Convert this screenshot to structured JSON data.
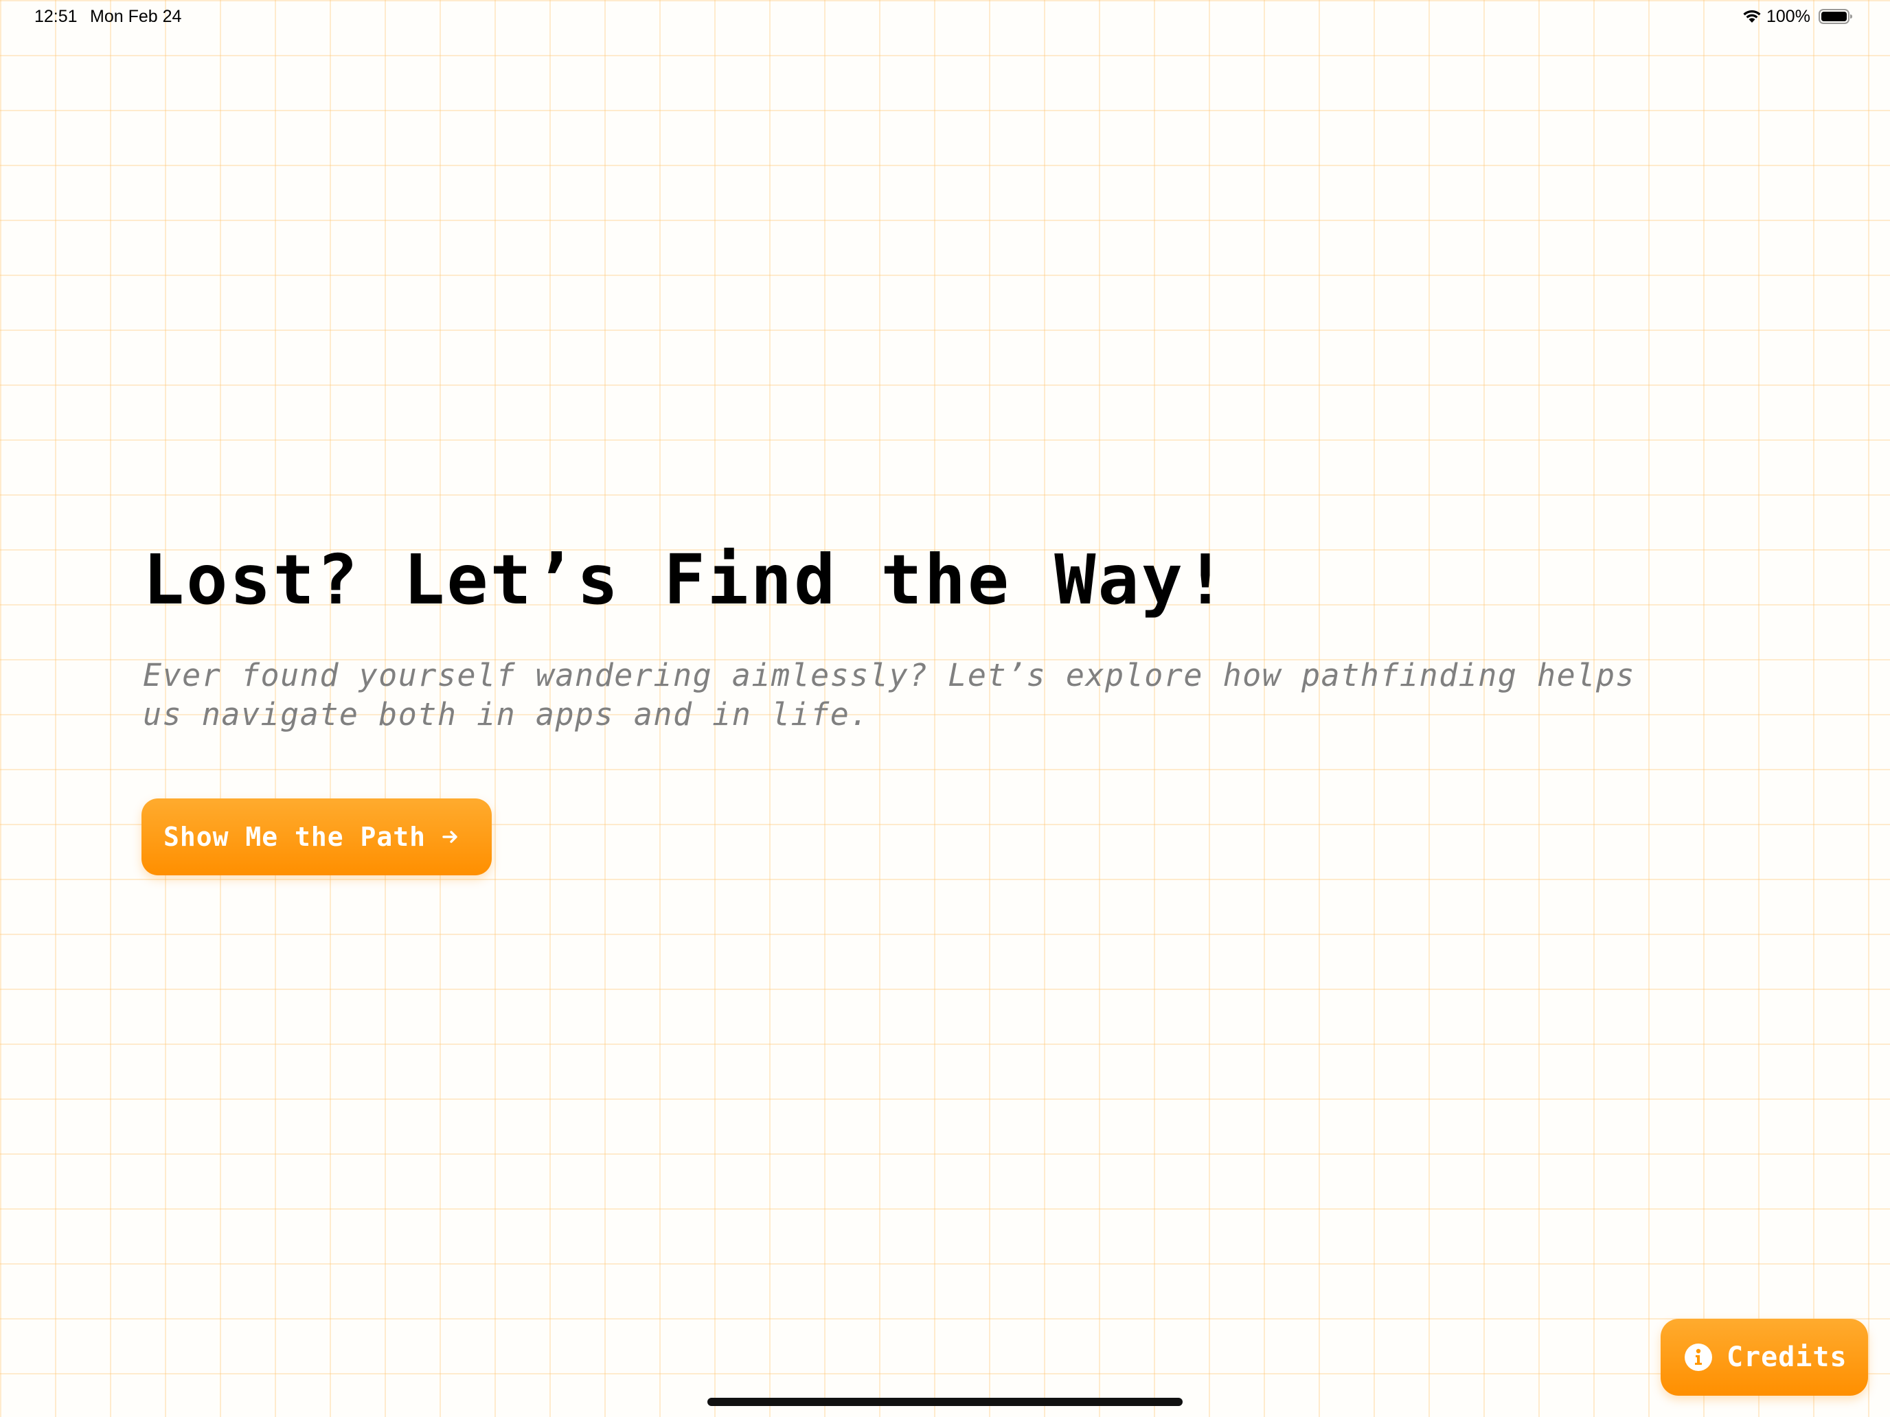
{
  "status_bar": {
    "time": "12:51",
    "date": "Mon Feb 24",
    "battery_percent": "100%",
    "battery_level": 1.0,
    "icons": [
      "wifi-icon",
      "battery-icon"
    ]
  },
  "hero": {
    "title": "Lost? Let’s Find the Way!",
    "subtitle": "Ever found yourself wandering aimlessly? Let’s explore how pathfinding helps us navigate both in apps and in life."
  },
  "actions": {
    "primary_label": "Show Me the Path",
    "primary_icon": "arrow-right-icon",
    "credits_label": "Credits",
    "credits_icon": "info-icon"
  },
  "colors": {
    "accent": "#ff9800",
    "accent_light": "#ffab2e",
    "grid_line": "#ffe3bc",
    "background": "#fffefb",
    "title": "#000000",
    "subtitle": "#808080"
  }
}
